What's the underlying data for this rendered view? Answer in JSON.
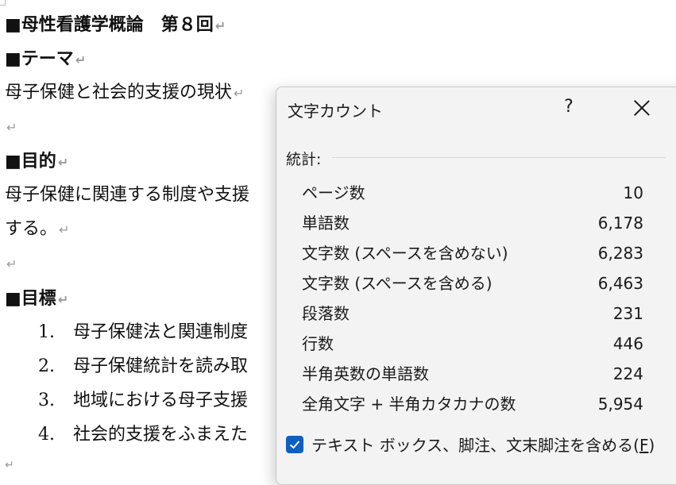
{
  "document": {
    "title": "■母性看護学概論　第８回",
    "theme_heading": "■テーマ",
    "theme_text": "母子保健と社会的支援の現状",
    "purpose_heading": "■目的",
    "purpose_text_1": "母子保健に関連する制度や支援",
    "purpose_text_2": "する。",
    "goals_heading": "■目標",
    "goals": [
      {
        "num": "1.",
        "text": "母子保健法と関連制度"
      },
      {
        "num": "2.",
        "text": "母子保健統計を読み取"
      },
      {
        "num": "3.",
        "text": "地域における母子支援"
      },
      {
        "num": "4.",
        "text": "社会的支援をふまえた"
      }
    ],
    "paragraph_mark": "↵"
  },
  "dialog": {
    "title": "文字カウント",
    "help_label": "?",
    "section_label": "統計:",
    "stats": [
      {
        "label": "ページ数",
        "value": "10"
      },
      {
        "label": "単語数",
        "value": "6,178"
      },
      {
        "label": "文字数 (スペースを含めない)",
        "value": "6,283"
      },
      {
        "label": "文字数 (スペースを含める)",
        "value": "6,463"
      },
      {
        "label": "段落数",
        "value": "231"
      },
      {
        "label": "行数",
        "value": "446"
      },
      {
        "label": "半角英数の単語数",
        "value": "224"
      },
      {
        "label": "全角文字 + 半角カタカナの数",
        "value": "5,954"
      }
    ],
    "checkbox_label": "テキスト ボックス、脚注、文末脚注を含める(",
    "checkbox_accel": "F",
    "checkbox_suffix": ")",
    "checkbox_checked": true,
    "accent_color": "#0f5fc0"
  }
}
